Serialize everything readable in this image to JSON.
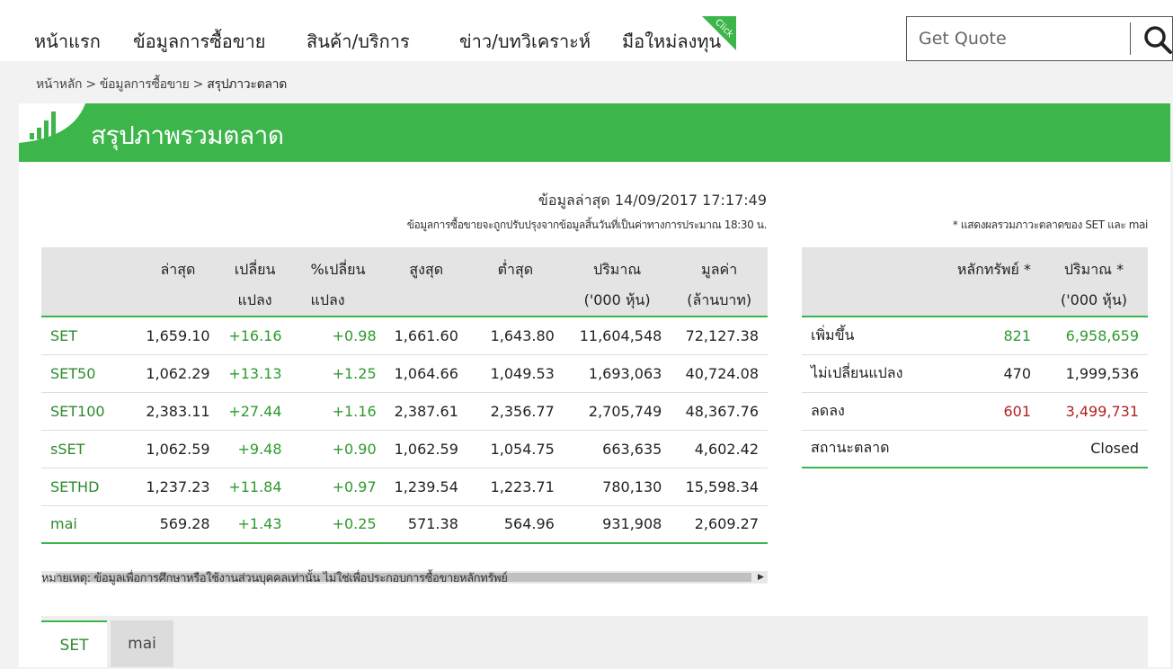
{
  "nav": {
    "items": [
      "หน้าแรก",
      "ข้อมูลการซื้อขาย",
      "สินค้า/บริการ",
      "ข่าว/บทวิเคราะห์",
      "มือใหม่ลงทุน"
    ],
    "new_badge": "Click",
    "search_placeholder": "Get Quote",
    "accent": "#3cb54a"
  },
  "breadcrumb": {
    "home": "หน้าหลัก",
    "sep": ">",
    "section": "ข้อมูลการซื้อขาย",
    "current": "สรุปภาวะตลาด"
  },
  "banner": {
    "title": "สรุปภาพรวมตลาด",
    "icon": "bar-chart-icon"
  },
  "updated": "ข้อมูลล่าสุด 14/09/2017 17:17:49",
  "note_top": "ข้อมูลการซื้อขายจะถูกปรับปรุงจากข้อมูลสิ้นวันที่เป็นค่าทางการประมาณ 18:30 น.",
  "note_right": "* แสดงผลรวมภาวะตลาดของ SET และ mai",
  "index_table": {
    "headers": [
      [
        "",
        ""
      ],
      [
        "ล่าสุด",
        ""
      ],
      [
        "เปลี่ยน",
        "แปลง"
      ],
      [
        "%เปลี่ยน",
        "แปลง"
      ],
      [
        "สูงสุด",
        ""
      ],
      [
        "ต่ำสุด",
        ""
      ],
      [
        "ปริมาณ",
        "('000 หุ้น)"
      ],
      [
        "มูลค่า",
        "(ล้านบาท)"
      ]
    ],
    "rows": [
      [
        "SET",
        "1,659.10",
        "+16.16",
        "+0.98",
        "1,661.60",
        "1,643.80",
        "11,604,548",
        "72,127.38"
      ],
      [
        "SET50",
        "1,062.29",
        "+13.13",
        "+1.25",
        "1,064.66",
        "1,049.53",
        "1,693,063",
        "40,724.08"
      ],
      [
        "SET100",
        "2,383.11",
        "+27.44",
        "+1.16",
        "2,387.61",
        "2,356.77",
        "2,705,749",
        "48,367.76"
      ],
      [
        "sSET",
        "1,062.59",
        "+9.48",
        "+0.90",
        "1,062.59",
        "1,054.75",
        "663,635",
        "4,602.42"
      ],
      [
        "SETHD",
        "1,237.23",
        "+11.84",
        "+0.97",
        "1,239.54",
        "1,223.71",
        "780,130",
        "15,598.34"
      ],
      [
        "mai",
        "569.28",
        "+1.43",
        "+0.25",
        "571.38",
        "564.96",
        "931,908",
        "2,609.27"
      ]
    ]
  },
  "breadth_table": {
    "headers": [
      [
        "",
        ""
      ],
      [
        "หลักทรัพย์ *",
        ""
      ],
      [
        "ปริมาณ *",
        "('000 หุ้น)"
      ]
    ],
    "rows": [
      [
        "เพิ่มขึ้น",
        "821",
        "6,958,659"
      ],
      [
        "ไม่เปลี่ยนแปลง",
        "470",
        "1,999,536"
      ],
      [
        "ลดลง",
        "601",
        "3,499,731"
      ]
    ],
    "status_label": "สถานะตลาด",
    "status_value": "Closed"
  },
  "disclaimer": "หมายเหตุ: ข้อมูลเพื่อการศึกษาหรือใช้งานส่วนบุคคลเท่านั้น ไม่ใช่เพื่อประกอบการซื้อขายหลักทรัพย์",
  "tabs": [
    "SET",
    "mai"
  ],
  "colors": {
    "up": "#2e9a2e",
    "down": "#b22222",
    "index_name": "#2e8b2e"
  }
}
